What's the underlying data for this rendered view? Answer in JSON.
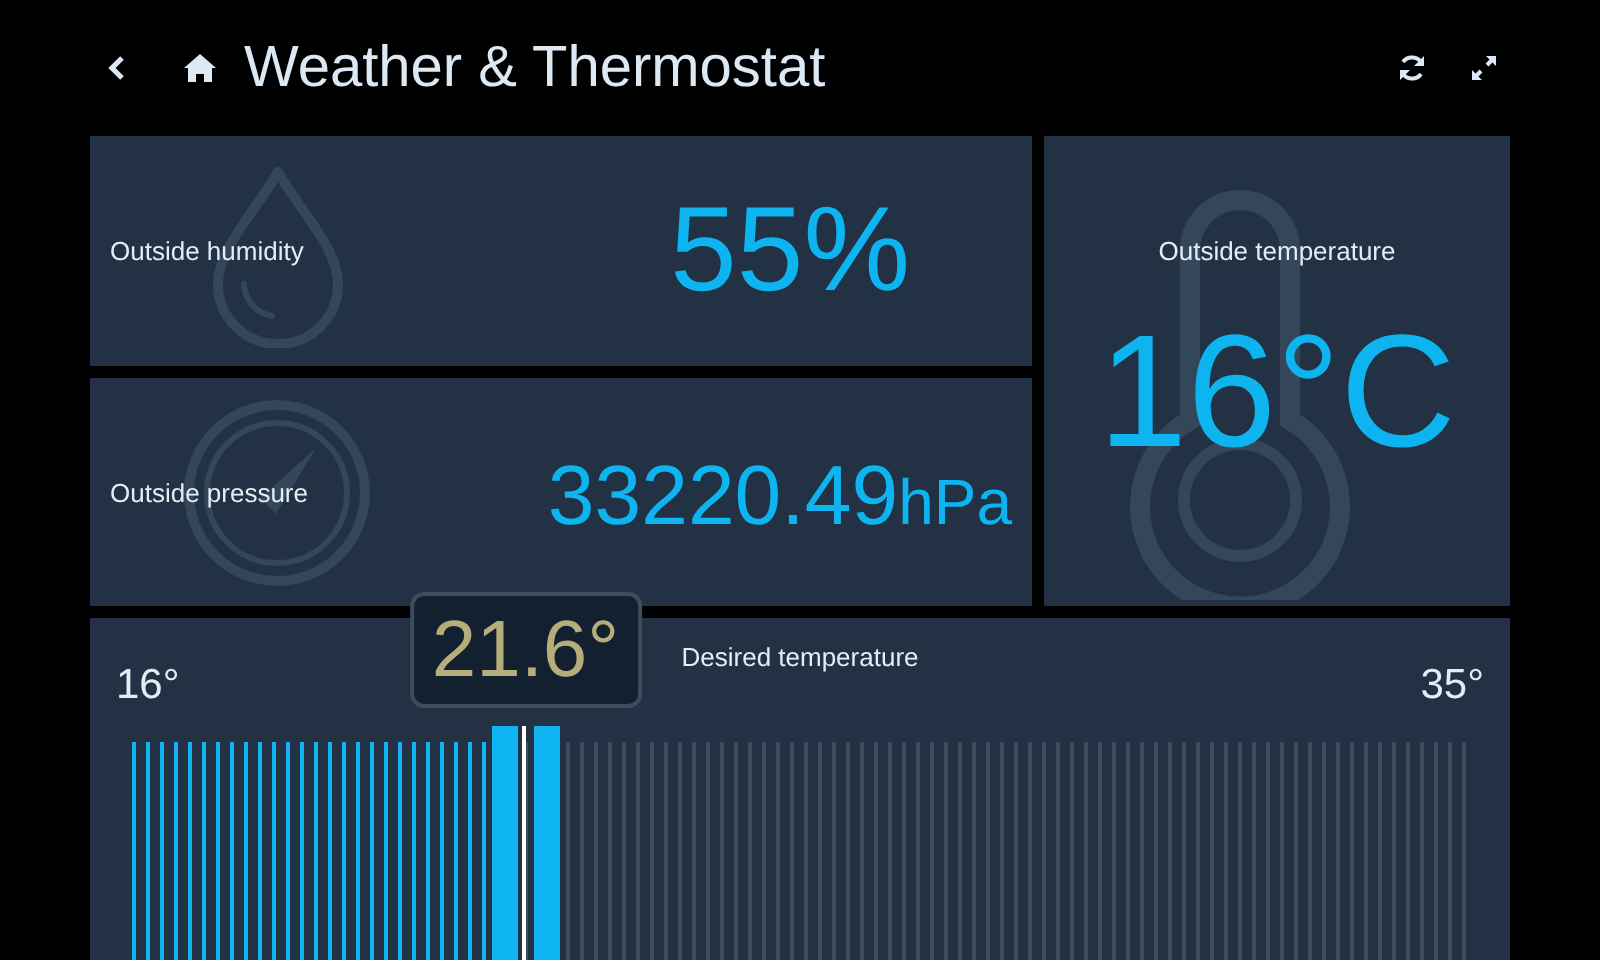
{
  "header": {
    "title": "Weather & Thermostat"
  },
  "tiles": [
    {
      "kind": "humidity",
      "label": "Outside humidity",
      "value": "55%"
    },
    {
      "kind": "pressure",
      "label": "Outside pressure",
      "value": "33220.49",
      "unit": "hPa"
    },
    {
      "kind": "temperature",
      "label": "Outside temperature",
      "value": "16°C"
    }
  ],
  "thermostat": {
    "label": "Desired temperature",
    "min": "16°",
    "max": "35°",
    "reading": "21.6°",
    "level": 0.295
  }
}
